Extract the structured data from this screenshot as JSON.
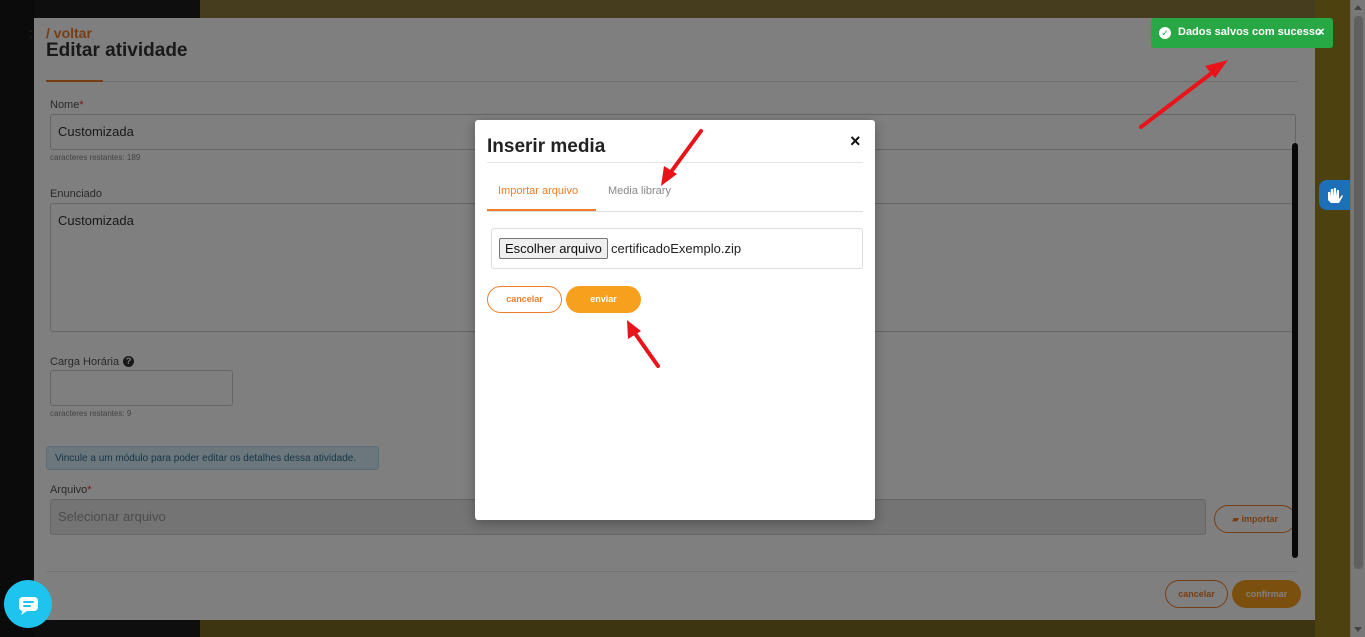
{
  "page": {
    "breadcrumb": "/ voltar",
    "title": "Editar atividade",
    "nome": {
      "label": "Nome",
      "value": "Customizada",
      "hint": "caracteres restantes: 189"
    },
    "enunciado": {
      "label": "Enunciado",
      "value": "Customizada"
    },
    "carga_horaria": {
      "label": "Carga Horária",
      "value": "",
      "hint": "caracteres restantes: 9"
    },
    "info_message": "Vincule a um módulo para poder editar os detalhes dessa atividade.",
    "arquivo": {
      "label": "Arquivo",
      "placeholder": "Selecionar arquivo",
      "import_label": "importar"
    },
    "footer": {
      "cancel_label": "cancelar",
      "confirm_label": "confirmar"
    }
  },
  "modal": {
    "title": "Inserir media",
    "close_label": "×",
    "tabs": [
      {
        "label": "Importar arquivo",
        "active": true
      },
      {
        "label": "Media library",
        "active": false
      }
    ],
    "file_button_label": "Escolher arquivo",
    "file_name": "certificadoExemplo.zip",
    "cancel_label": "cancelar",
    "send_label": "enviar"
  },
  "toast": {
    "message": "Dados salvos com sucesso",
    "close_label": "×",
    "color": "#28a745"
  },
  "colors": {
    "accent": "#ef7d2a",
    "primary_button": "#f7a01e",
    "chat_button": "#1ec3ee",
    "accessibility_button": "#1d6fb8"
  },
  "icons": {
    "toast": "check-circle-icon",
    "chat": "chat-bubble-icon",
    "accessibility": "sign-language-hand-icon",
    "import": "folder-open-icon",
    "help": "question-circle-icon"
  }
}
